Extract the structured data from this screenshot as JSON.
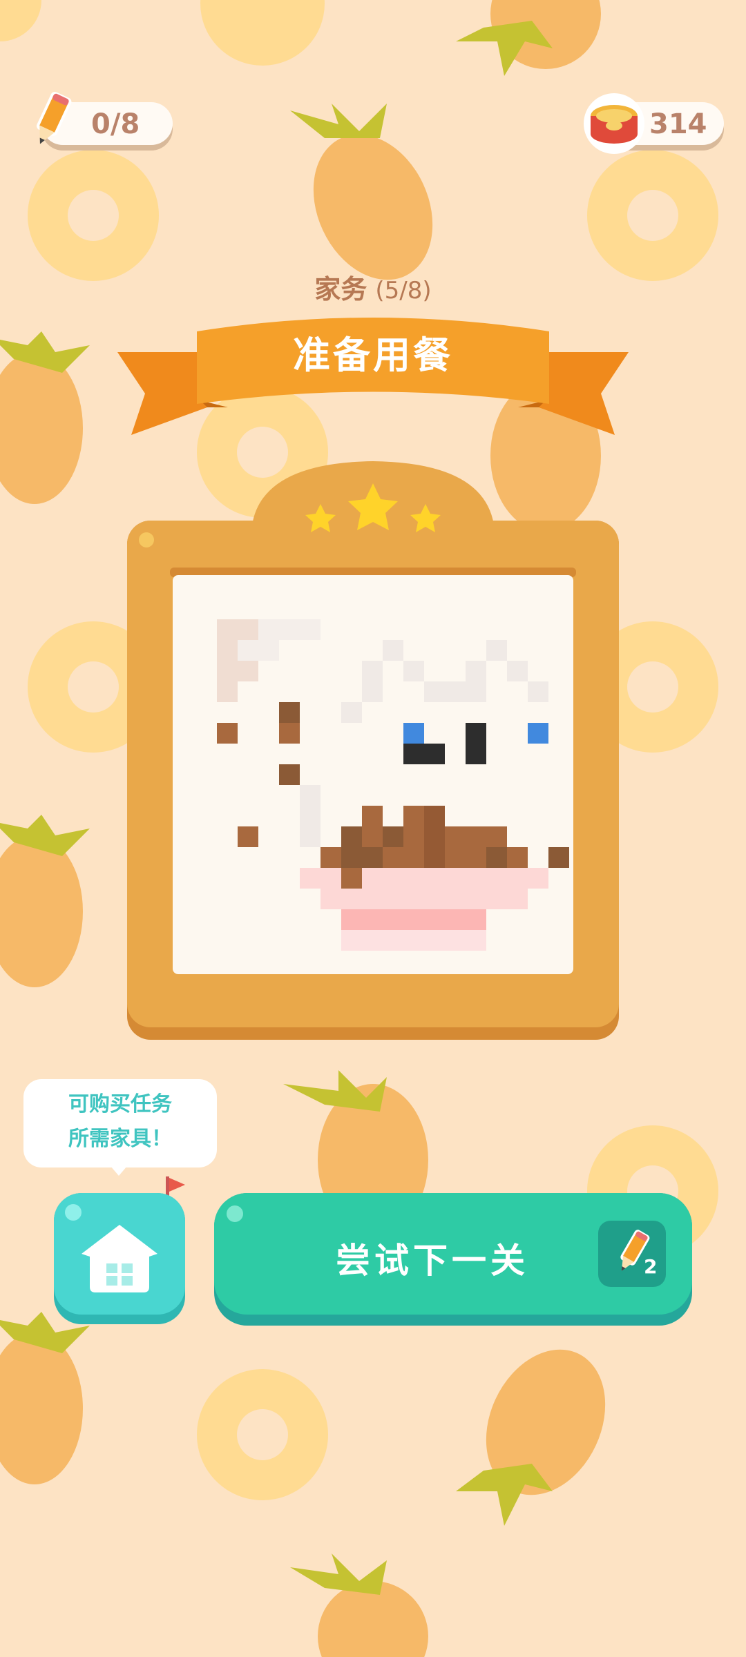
{
  "hud": {
    "pencils": "0/8",
    "coins": "314",
    "pencil_icon": "pencil-icon",
    "coin_icon": "coin-can-icon"
  },
  "task": {
    "category": "家务",
    "progress": "(5/8)",
    "title": "准备用餐"
  },
  "stars": {
    "earned": 3,
    "total": 3
  },
  "hint": {
    "line1": "可购买任务",
    "line2": "所需家具！"
  },
  "actions": {
    "home_icon": "home-icon",
    "next_label": "尝试下一关",
    "next_cost": "2",
    "next_cost_icon": "pencil-icon"
  },
  "colors": {
    "background": "#fde3c4",
    "ribbon": "#f5a02a",
    "frame": "#e9a84a",
    "accent_teal": "#2ecba5",
    "home_teal": "#49d6d0",
    "text_brown": "#b67853"
  }
}
